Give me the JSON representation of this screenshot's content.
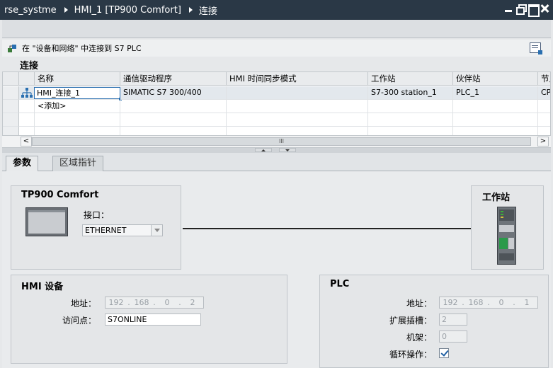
{
  "titlebar": {
    "project": "rse_systme",
    "device": "HMI_1 [TP900 Comfort]",
    "page": "连接"
  },
  "table_header": {
    "action_label": "在 \"设备和网络\" 中连接到 S7 PLC"
  },
  "section_title": "连接",
  "grid": {
    "columns": [
      "名称",
      "通信驱动程序",
      "HMI 时间同步模式",
      "工作站",
      "伙伴站",
      "节点"
    ],
    "rows": [
      {
        "name": "HMI_连接_1",
        "driver": "SIMATIC S7 300/400",
        "sync_mode": "",
        "station": "S7-300 station_1",
        "partner": "PLC_1",
        "node": "CPU"
      }
    ],
    "add_label": "<添加>",
    "scroll_left": "<",
    "scroll_right": ">",
    "scroll_grip": "III"
  },
  "tabs": [
    {
      "label": "参数",
      "active": true
    },
    {
      "label": "区域指针",
      "active": false
    }
  ],
  "hmi_panel": {
    "title": "TP900 Comfort",
    "interface_label": "接口：",
    "interface_value": "ETHERNET"
  },
  "station_panel": {
    "title": "工作站"
  },
  "hmi_device": {
    "title": "HMI 设备",
    "address_label": "地址：",
    "address": [
      "192",
      "168",
      "0",
      "2"
    ],
    "access_point_label": "访问点：",
    "access_point": "S7ONLINE"
  },
  "plc": {
    "title": "PLC",
    "address_label": "地址：",
    "address": [
      "192",
      "168",
      "0",
      "1"
    ],
    "slot_label": "扩展插槽：",
    "slot": "2",
    "rack_label": "机架：",
    "rack": "0",
    "cyclic_label": "循环操作：",
    "cyclic_checked": true
  },
  "colors": {
    "titlebar": "#2a3846",
    "accent": "#2a6fb0"
  }
}
